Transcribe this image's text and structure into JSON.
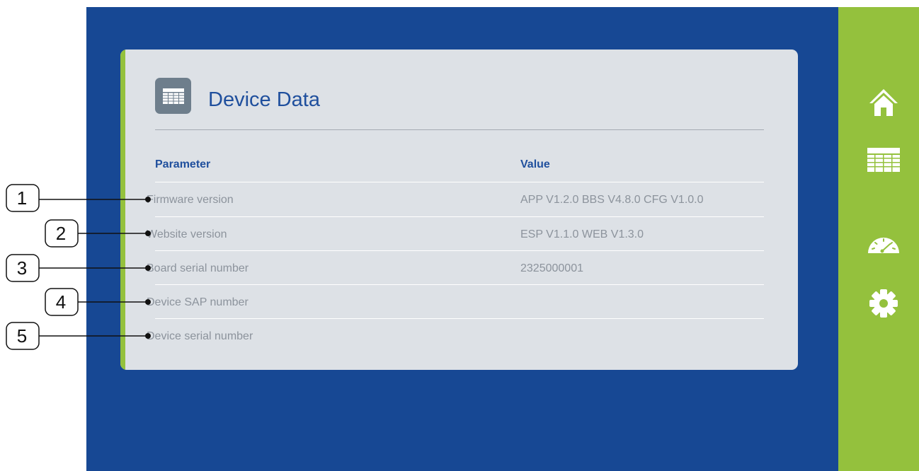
{
  "card": {
    "title": "Device Data",
    "header_icon": "table-icon",
    "columns": {
      "parameter": "Parameter",
      "value": "Value"
    },
    "rows": [
      {
        "label": "Firmware version",
        "value": "APP V1.2.0 BBS V4.8.0 CFG V1.0.0"
      },
      {
        "label": "Website version",
        "value": "ESP V1.1.0 WEB V1.3.0"
      },
      {
        "label": "Board serial number",
        "value": "2325000001"
      },
      {
        "label": "Device SAP number",
        "value": ""
      },
      {
        "label": "Device serial number",
        "value": ""
      }
    ]
  },
  "sidebar": {
    "items": [
      {
        "icon": "home-icon"
      },
      {
        "icon": "table-icon"
      },
      {
        "icon": "gauge-icon"
      },
      {
        "icon": "gear-icon"
      }
    ]
  },
  "callouts": [
    "1",
    "2",
    "3",
    "4",
    "5"
  ],
  "colors": {
    "background": "#174894",
    "sidebar": "#94c13d",
    "card": "#dde1e6",
    "title": "#1f4f9d",
    "row_text": "#8c939c"
  }
}
